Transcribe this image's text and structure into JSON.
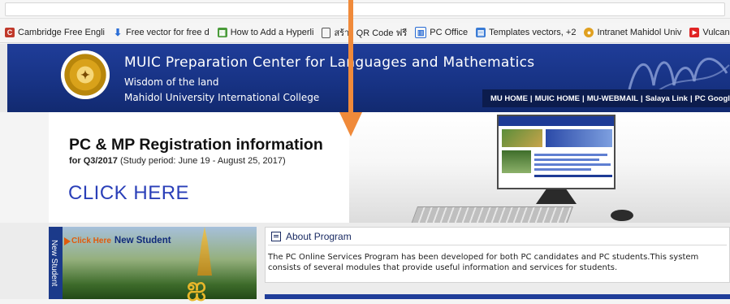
{
  "bookmarks": [
    {
      "icon": "cambridge-icon",
      "icon_color": "#c0392b",
      "label": "Cambridge Free Engli"
    },
    {
      "icon": "download-arrow-icon",
      "icon_color": "#2a6dd6",
      "label": "Free vector for free d"
    },
    {
      "icon": "tutorial-icon",
      "icon_color": "#4a9b3a",
      "label": "How to Add a Hyperli"
    },
    {
      "icon": "page-icon",
      "icon_color": "#555555",
      "label": "สร้าง QR Code ฟรี"
    },
    {
      "icon": "pc-office-icon",
      "icon_color": "#2a6dd6",
      "label": "PC Office"
    },
    {
      "icon": "templates-icon",
      "icon_color": "#3a7bd5",
      "label": "Templates vectors, +2"
    },
    {
      "icon": "intranet-icon",
      "icon_color": "#e0a020",
      "label": "Intranet Mahidol Univ"
    },
    {
      "icon": "youtube-icon",
      "icon_color": "#e02424",
      "label": "Vulcan Technology -"
    }
  ],
  "header": {
    "title": "MUIC Preparation Center for Languages and Mathematics",
    "subtitle1": "Wisdom of the land",
    "subtitle2": "Mahidol University International College",
    "links": [
      "MU HOME",
      "MUIC HOME",
      "MU-WEBMAIL",
      "Salaya Link",
      "PC Google Site"
    ],
    "logo_color": "#d9a21a",
    "brand_color": "#1f3d99"
  },
  "banner": {
    "title": "PC & MP Registration information",
    "sub_term": "for Q3/2017",
    "sub_period": "(Study period: June 19 - August 25, 2017)",
    "cta": "CLICK HERE"
  },
  "new_student": {
    "vertical_label": "New Student",
    "click_label": "Click Here",
    "title": "New Student"
  },
  "about": {
    "heading": "About Program",
    "text": "The PC Online Services Program has been developed for both PC candidates and PC students.This system consists of several modules that provide useful information and services for students."
  },
  "annotation": {
    "arrow_color": "#f08a3a"
  }
}
